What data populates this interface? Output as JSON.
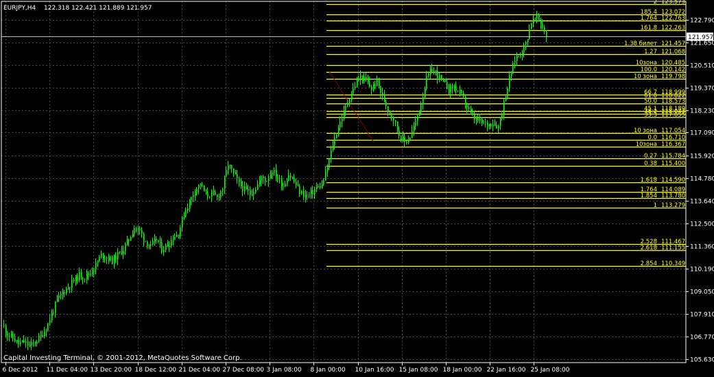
{
  "header": {
    "symbol_label": "EURJPY,H4",
    "ohlc": "122.318 122.421 121.889 121.957"
  },
  "copyright": "Capital Investing Terminal, © 2001-2012, MetaQuotes Software Corp.",
  "colors": {
    "background": "#000000",
    "candles": "#00ff00",
    "grid": "#4a4a4a",
    "fib_levels": "#ffff00",
    "axis_text": "#ffffff",
    "price_line": "#c0c0c0",
    "trend_line": "#8b0000"
  },
  "chart_data": {
    "type": "candlestick",
    "symbol": "EURJPY",
    "timeframe": "H4",
    "current_price": "121.957",
    "y_ticks": [
      "122.790",
      "121.650",
      "120.510",
      "119.370",
      "118.230",
      "117.090",
      "115.920",
      "114.780",
      "113.640",
      "112.500",
      "111.360",
      "110.190",
      "109.050",
      "107.910",
      "106.770",
      "105.630"
    ],
    "x_ticks": [
      "6 Dec 2012",
      "11 Dec 04:00",
      "13 Dec 20:00",
      "18 Dec 12:00",
      "21 Dec 04:00",
      "27 Dec 08:00",
      "3 Jan 08:00",
      "8 Jan 00:00",
      "10 Jan 16:00",
      "15 Jan 08:00",
      "18 Jan 00:00",
      "22 Jan 16:00",
      "25 Jan 08:00"
    ],
    "price_path": [
      [
        0,
        107.3
      ],
      [
        2,
        106.9
      ],
      [
        5,
        106.7
      ],
      [
        8,
        106.4
      ],
      [
        11,
        106.5
      ],
      [
        14,
        106.3
      ],
      [
        17,
        106.5
      ],
      [
        20,
        106.8
      ],
      [
        23,
        107.2
      ],
      [
        26,
        107.9
      ],
      [
        29,
        108.6
      ],
      [
        32,
        109.0
      ],
      [
        35,
        109.3
      ],
      [
        38,
        109.6
      ],
      [
        41,
        109.9
      ],
      [
        44,
        109.8
      ],
      [
        47,
        110.0
      ],
      [
        50,
        110.4
      ],
      [
        53,
        110.9
      ],
      [
        56,
        110.8
      ],
      [
        59,
        110.6
      ],
      [
        62,
        110.9
      ],
      [
        65,
        111.2
      ],
      [
        68,
        111.7
      ],
      [
        71,
        112.3
      ],
      [
        74,
        112.1
      ],
      [
        77,
        111.6
      ],
      [
        80,
        111.3
      ],
      [
        83,
        111.7
      ],
      [
        86,
        111.2
      ],
      [
        89,
        111.4
      ],
      [
        92,
        111.8
      ],
      [
        95,
        112.0
      ],
      [
        98,
        113.0
      ],
      [
        101,
        113.6
      ],
      [
        104,
        114.2
      ],
      [
        107,
        114.5
      ],
      [
        110,
        113.9
      ],
      [
        113,
        114.0
      ],
      [
        116,
        113.8
      ],
      [
        119,
        114.3
      ],
      [
        122,
        115.5
      ],
      [
        125,
        115.0
      ],
      [
        128,
        114.5
      ],
      [
        131,
        114.2
      ],
      [
        134,
        114.0
      ],
      [
        137,
        114.3
      ],
      [
        140,
        114.8
      ],
      [
        143,
        114.7
      ],
      [
        146,
        115.2
      ],
      [
        149,
        114.8
      ],
      [
        152,
        114.4
      ],
      [
        155,
        115.0
      ],
      [
        158,
        114.6
      ],
      [
        161,
        114.1
      ],
      [
        164,
        113.9
      ],
      [
        167,
        114.0
      ],
      [
        170,
        114.3
      ],
      [
        173,
        114.4
      ],
      [
        176,
        115.3
      ],
      [
        179,
        116.5
      ],
      [
        182,
        117.4
      ],
      [
        185,
        118.1
      ],
      [
        188,
        118.9
      ],
      [
        191,
        119.5
      ],
      [
        194,
        119.9
      ],
      [
        197,
        119.7
      ],
      [
        200,
        119.3
      ],
      [
        203,
        119.7
      ],
      [
        206,
        118.9
      ],
      [
        209,
        118.3
      ],
      [
        212,
        117.8
      ],
      [
        215,
        117.0
      ],
      [
        218,
        116.6
      ],
      [
        221,
        116.9
      ],
      [
        224,
        117.6
      ],
      [
        227,
        118.6
      ],
      [
        230,
        119.8
      ],
      [
        233,
        120.3
      ],
      [
        236,
        120.0
      ],
      [
        239,
        119.6
      ],
      [
        242,
        119.3
      ],
      [
        245,
        119.4
      ],
      [
        248,
        119.1
      ],
      [
        251,
        118.6
      ],
      [
        254,
        118.0
      ],
      [
        257,
        117.7
      ],
      [
        260,
        117.6
      ],
      [
        263,
        117.5
      ],
      [
        266,
        117.6
      ],
      [
        269,
        117.4
      ],
      [
        272,
        118.6
      ],
      [
        275,
        119.8
      ],
      [
        278,
        120.8
      ],
      [
        281,
        121.1
      ],
      [
        284,
        121.6
      ],
      [
        287,
        122.7
      ],
      [
        290,
        122.9
      ],
      [
        293,
        122.5
      ],
      [
        295,
        121.96
      ]
    ],
    "fib_levels": [
      {
        "label": "2",
        "price": "123.573"
      },
      {
        "label": "185.4",
        "price": "123.072"
      },
      {
        "label": "1.764",
        "price": "122.763"
      },
      {
        "label": "161.8",
        "price": "122.263"
      },
      {
        "label": "1.38 билет",
        "price": "121.457"
      },
      {
        "label": "1.27",
        "price": "121.068"
      },
      {
        "label": "10зона",
        "price": "120.485"
      },
      {
        "label": "100.0",
        "price": "120.142"
      },
      {
        "label": "10 зона",
        "price": "119.798"
      },
      {
        "label": "66.7",
        "price": "118.999"
      },
      {
        "label": "61.8",
        "price": "118.822"
      },
      {
        "label": "50.0",
        "price": "118.573"
      },
      {
        "label": "45.1",
        "price": "118.189"
      },
      {
        "label": "38.2",
        "price": "118.043"
      },
      {
        "label": "33.3",
        "price": "117.855"
      },
      {
        "label": "10 зона",
        "price": "117.054"
      },
      {
        "label": "0.0",
        "price": "116.710"
      },
      {
        "label": "10зона",
        "price": "116.367"
      },
      {
        "label": "0.27",
        "price": "115.784"
      },
      {
        "label": "0.38",
        "price": "115.400"
      },
      {
        "label": "1.618",
        "price": "114.590"
      },
      {
        "label": "1.764",
        "price": "114.089"
      },
      {
        "label": "1.854",
        "price": "113.780"
      },
      {
        "label": "1",
        "price": "113.279"
      },
      {
        "label": "2.528",
        "price": "111.467"
      },
      {
        "label": "2.618",
        "price": "111.155"
      },
      {
        "label": "2.854",
        "price": "110.349"
      }
    ]
  }
}
